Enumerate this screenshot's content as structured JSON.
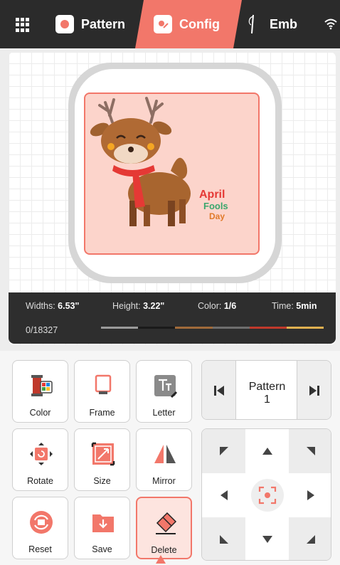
{
  "tabs": [
    {
      "label": "Pattern",
      "icon": "pattern-icon"
    },
    {
      "label": "Config",
      "icon": "config-icon",
      "active": true
    },
    {
      "label": "Emb",
      "icon": "needle-icon"
    }
  ],
  "status": {
    "width_label": "Widths:",
    "width_value": "6.53\"",
    "height_label": "Height:",
    "height_value": "3.22\"",
    "color_label": "Color:",
    "color_value": "1/6",
    "time_label": "Time:",
    "time_value": "5min",
    "progress": "0/18327"
  },
  "thread_colors": [
    "#9a9a9a",
    "#1a1a1a",
    "#a06a3a",
    "#6e6e6e",
    "#c0392b",
    "#e0b050"
  ],
  "design_text": [
    "April",
    "Fools",
    "Day"
  ],
  "tools": [
    {
      "label": "Color",
      "icon": "thread-color-icon"
    },
    {
      "label": "Frame",
      "icon": "frame-icon"
    },
    {
      "label": "Letter",
      "icon": "letter-icon"
    },
    {
      "label": "Rotate",
      "icon": "rotate-icon"
    },
    {
      "label": "Size",
      "icon": "resize-icon"
    },
    {
      "label": "Mirror",
      "icon": "mirror-icon"
    },
    {
      "label": "Reset",
      "icon": "reset-icon"
    },
    {
      "label": "Save",
      "icon": "save-folder-icon"
    },
    {
      "label": "Delete",
      "icon": "eraser-icon",
      "active": true
    }
  ],
  "pattern_nav": {
    "label": "Pattern",
    "number": "1"
  },
  "accent": "#f2776a"
}
